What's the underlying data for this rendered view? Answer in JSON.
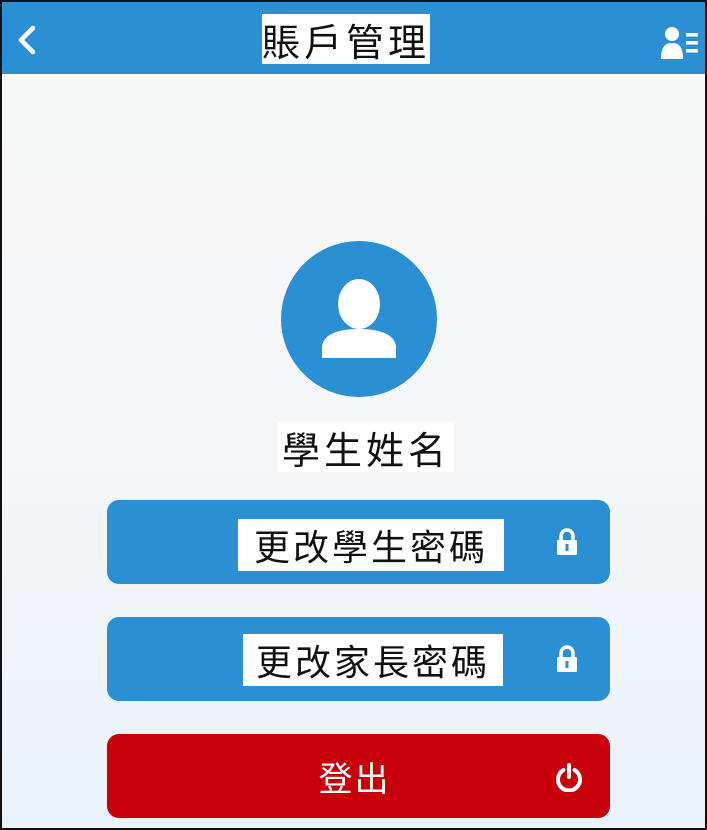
{
  "header": {
    "title": "賬戶管理",
    "back_icon": "chevron-left-icon",
    "user_list_icon": "user-list-icon",
    "bg_color": "#2b8fd3"
  },
  "profile": {
    "avatar_icon": "user-avatar-icon",
    "student_name": "學生姓名"
  },
  "actions": {
    "change_student_password": {
      "label": "更改學生密碼",
      "icon": "lock-icon"
    },
    "change_parent_password": {
      "label": "更改家長密碼",
      "icon": "lock-icon"
    },
    "logout": {
      "label": "登出",
      "icon": "power-icon",
      "color": "#c8000c"
    }
  }
}
